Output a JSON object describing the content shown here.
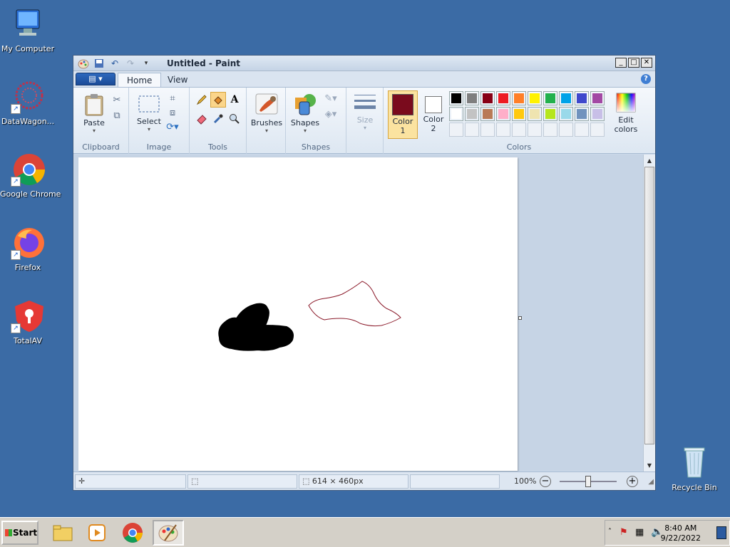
{
  "desktop": {
    "icons": [
      {
        "label": "My Computer"
      },
      {
        "label": "DataWagon..."
      },
      {
        "label": "Google Chrome"
      },
      {
        "label": "Firefox"
      },
      {
        "label": "TotalAV"
      },
      {
        "label": "Recycle Bin"
      }
    ]
  },
  "window": {
    "title": "Untitled - Paint",
    "tabs": [
      {
        "label": "Home"
      },
      {
        "label": "View"
      }
    ],
    "help": "?"
  },
  "ribbon": {
    "clipboard": {
      "paste": "Paste",
      "group": "Clipboard"
    },
    "image": {
      "select": "Select",
      "group": "Image"
    },
    "tools": {
      "group": "Tools",
      "text_tool": "A"
    },
    "brushes": {
      "label": "Brushes"
    },
    "shapes": {
      "label": "Shapes",
      "group": "Shapes"
    },
    "size": {
      "label": "Size"
    },
    "colors": {
      "color1": "Color\n1",
      "color1_a": "Color",
      "color1_b": "1",
      "color2_a": "Color",
      "color2_b": "2",
      "edit_a": "Edit",
      "edit_b": "colors",
      "group": "Colors",
      "color1_value": "#7a0b1d",
      "color2_value": "#ffffff",
      "palette_row1": [
        "#000000",
        "#7f7f7f",
        "#880015",
        "#ed1c24",
        "#ff7f27",
        "#fff200",
        "#22b14c",
        "#00a2e8",
        "#3f48cc",
        "#a349a4"
      ],
      "palette_row2": [
        "#ffffff",
        "#c3c3c3",
        "#b97a57",
        "#ffaec9",
        "#ffc90e",
        "#efe4b0",
        "#b5e61d",
        "#99d9ea",
        "#7092be",
        "#c8bfe7"
      ]
    }
  },
  "status": {
    "dimensions": "614 × 460px",
    "zoom": "100%"
  },
  "taskbar": {
    "start": "Start",
    "time": "8:40 AM",
    "date": "9/22/2022"
  }
}
